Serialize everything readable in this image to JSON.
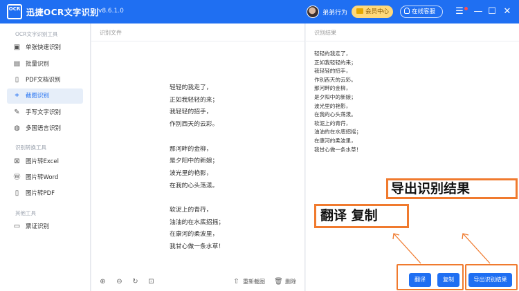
{
  "app": {
    "logo_text": "OCR",
    "title": "迅捷OCR文字识别",
    "version": "v8.6.1.0",
    "user_name": "弟弟行为",
    "vip_label": "会员中心",
    "support_label": "在线客服"
  },
  "window_controls": {
    "menu": "☰",
    "minimize": "—",
    "maximize": "☐",
    "close": "✕"
  },
  "sidebar": {
    "section1": "OCR文字识别工具",
    "section2": "识别转换工具",
    "section3": "其他工具",
    "items": [
      {
        "label": "单张快速识别",
        "icon": "camera-icon",
        "glyph": "▣"
      },
      {
        "label": "批量识别",
        "icon": "batch-icon",
        "glyph": "▤"
      },
      {
        "label": "PDF文档识别",
        "icon": "pdf-icon",
        "glyph": "▯"
      },
      {
        "label": "截图识别",
        "icon": "crop-icon",
        "glyph": "⌗"
      },
      {
        "label": "手写文字识别",
        "icon": "pen-icon",
        "glyph": "✎"
      },
      {
        "label": "多国语言识别",
        "icon": "globe-icon",
        "glyph": "◍"
      },
      {
        "label": "图片转Excel",
        "icon": "excel-icon",
        "glyph": "⊠"
      },
      {
        "label": "图片转Word",
        "icon": "word-icon",
        "glyph": "Ⓦ"
      },
      {
        "label": "图片转PDF",
        "icon": "pdf-file-icon",
        "glyph": "▯"
      },
      {
        "label": "票证识别",
        "icon": "ticket-icon",
        "glyph": "▭"
      }
    ],
    "active_index": 3
  },
  "left_panel": {
    "header": "识别文件",
    "poem": "轻轻的我走了，\n正如我轻轻的来；\n我轻轻的招手，\n作别西天的云彩。\n\n那河畔的金柳，\n是夕阳中的新娘；\n波光里的艳影，\n在我的心头荡漾。\n\n软泥上的青荇，\n油油的在水底招摇；\n在康河的柔波里，\n我甘心做一条水草！",
    "toolbar": {
      "zoom_in": "⊕",
      "zoom_out": "⊖",
      "rotate": "↻",
      "fit": "⊡",
      "recapture_icon": "⇧",
      "recapture_label": "重新截图",
      "delete_icon": "🗑",
      "delete_label": "删除"
    }
  },
  "right_panel": {
    "header": "识别结果",
    "result": "轻轻的我走了，\n正如我轻轻的来；\n我轻轻的招手，\n作别西天的云彩。\n那河畔的金柳，\n是夕阳中的新娘；\n波光里的艳影，\n在我的心头荡漾。\n软泥上的青荇，\n油油的在水底招摇；\n在康河的柔波里，\n我甘心做一条水草！",
    "buttons": {
      "translate": "翻译",
      "copy": "复制",
      "export": "导出识别结果"
    }
  },
  "annotations": {
    "export_callout": "导出识别结果",
    "translate_copy_callout": "翻译 复制"
  },
  "colors": {
    "accent": "#1f6ff2",
    "annotation": "#f07a2e",
    "vip": "#ffd97a"
  }
}
